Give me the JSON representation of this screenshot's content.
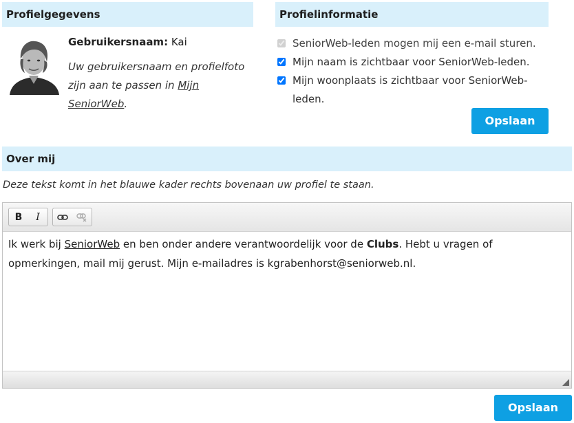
{
  "profile": {
    "header": "Profielgegevens",
    "username_label": "Gebruikersnaam:",
    "username_value": "Kai",
    "hint_text": "Uw gebruikersnaam en profielfoto zijn aan te passen in ",
    "hint_link": "Mijn SeniorWeb",
    "hint_end": "."
  },
  "info": {
    "header": "Profielinformatie",
    "options": [
      {
        "label": "SeniorWeb-leden mogen mij een e-mail sturen.",
        "checked": true,
        "disabled": true
      },
      {
        "label": "Mijn naam is zichtbaar voor SeniorWeb-leden.",
        "checked": true,
        "disabled": false
      },
      {
        "label": "Mijn woonplaats is zichtbaar voor SeniorWeb-leden.",
        "checked": true,
        "disabled": false
      }
    ],
    "save_label": "Opslaan"
  },
  "about": {
    "header": "Over mij",
    "intro": "Deze tekst komt in het blauwe kader rechts bovenaan uw profiel te staan.",
    "toolbar": {
      "bold": "B",
      "italic": "I"
    },
    "content": {
      "part1": "Ik werk bij ",
      "link": "SeniorWeb",
      "part2": " en ben onder andere verantwoordelijk voor de ",
      "bold": "Clubs",
      "part3": ". Hebt u vragen of opmerkingen, mail mij gerust. Mijn e-mailadres is kgrabenhorst@seniorweb.nl."
    },
    "save_label": "Opslaan"
  },
  "colors": {
    "header_bg": "#d9f0fb",
    "button_bg": "#0ea0e3"
  }
}
